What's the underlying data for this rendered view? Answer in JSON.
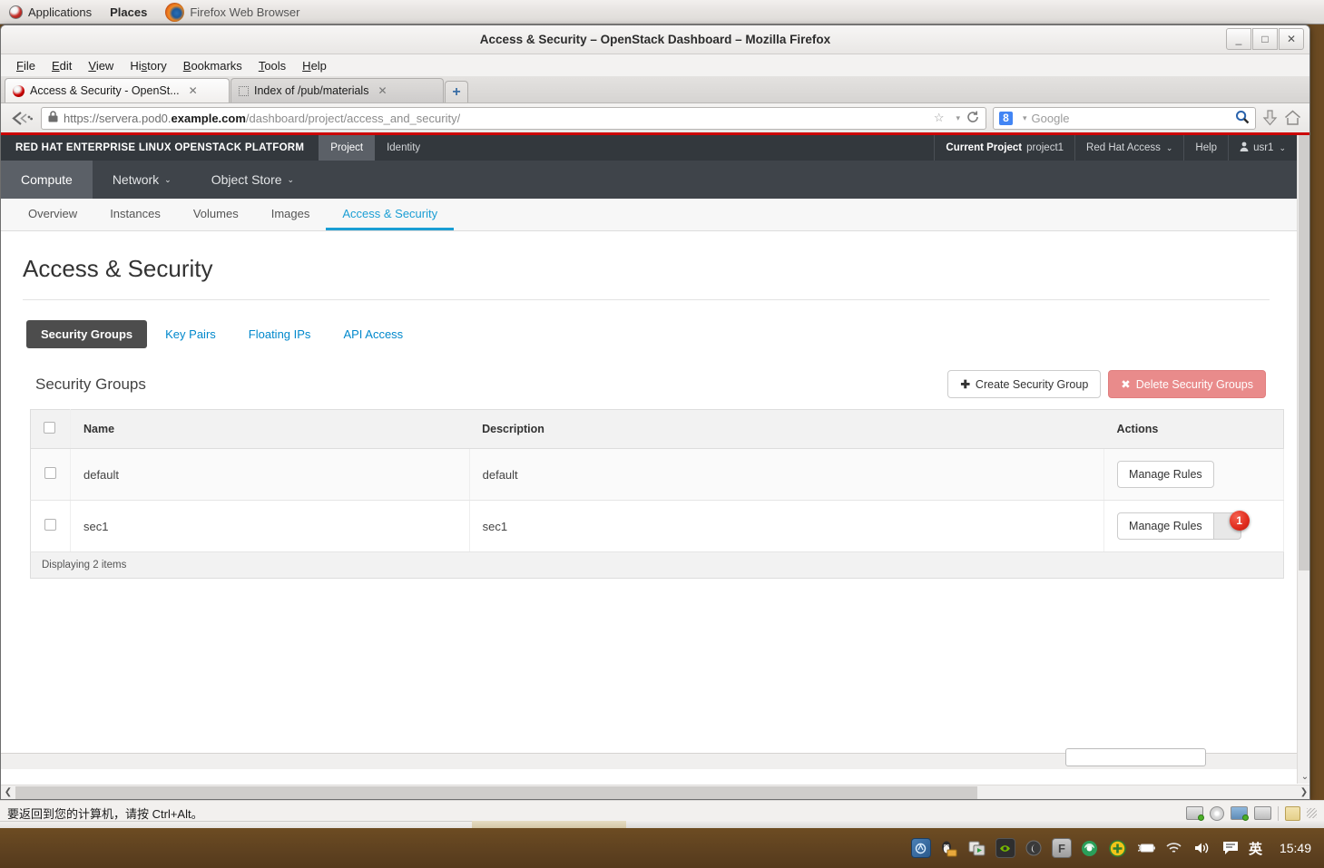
{
  "gnome_panel": {
    "applications": "Applications",
    "places": "Places",
    "window_label": "Firefox Web Browser"
  },
  "browser": {
    "window_title": "Access & Security – OpenStack Dashboard – Mozilla Firefox",
    "controls": {
      "minimize": "_",
      "maximize": "□",
      "close": "✕"
    },
    "menus": [
      "File",
      "Edit",
      "View",
      "History",
      "Bookmarks",
      "Tools",
      "Help"
    ],
    "tabs": [
      {
        "title": "Access & Security - OpenSt...",
        "close": "✕",
        "active": true
      },
      {
        "title": "Index of /pub/materials",
        "close": "✕",
        "active": false
      }
    ],
    "new_tab_label": "+",
    "url": {
      "scheme": "https://servera.pod0.",
      "domain": "example.com",
      "path": "/dashboard/project/access_and_security/"
    },
    "search": {
      "engine": "Google",
      "engine_badge": "8"
    }
  },
  "openstack": {
    "brand": "RED HAT ENTERPRISE LINUX OPENSTACK PLATFORM",
    "brand_sup": "®",
    "top_tabs": [
      {
        "label": "Project",
        "active": true
      },
      {
        "label": "Identity",
        "active": false
      }
    ],
    "top_right": {
      "current_project_label": "Current Project",
      "current_project_value": "project1",
      "red_hat_access": "Red Hat Access",
      "help": "Help",
      "user": "usr1"
    },
    "nav": [
      {
        "label": "Compute",
        "active": true,
        "caret": false
      },
      {
        "label": "Network",
        "active": false,
        "caret": true
      },
      {
        "label": "Object Store",
        "active": false,
        "caret": true
      }
    ],
    "subnav": [
      {
        "label": "Overview",
        "active": false
      },
      {
        "label": "Instances",
        "active": false
      },
      {
        "label": "Volumes",
        "active": false
      },
      {
        "label": "Images",
        "active": false
      },
      {
        "label": "Access & Security",
        "active": true
      }
    ],
    "page_title": "Access & Security",
    "pill_tabs": [
      {
        "label": "Security Groups",
        "active": true
      },
      {
        "label": "Key Pairs",
        "active": false
      },
      {
        "label": "Floating IPs",
        "active": false
      },
      {
        "label": "API Access",
        "active": false
      }
    ],
    "panel": {
      "title": "Security Groups",
      "create_button": "Create Security Group",
      "create_icon": "✚",
      "delete_button": "Delete Security Groups",
      "delete_icon": "✖"
    },
    "table": {
      "headers": [
        "Name",
        "Description",
        "Actions"
      ],
      "rows": [
        {
          "name": "default",
          "description": "default",
          "action": "Manage Rules",
          "badge": ""
        },
        {
          "name": "sec1",
          "description": "sec1",
          "action": "Manage Rules",
          "badge": "1"
        }
      ],
      "footer": "Displaying 2 items"
    },
    "accent_color": "#1a9ed4",
    "brandbar_color": "#33383d",
    "redbar_color": "#cc0000"
  },
  "vm_statusbar": {
    "message": "要返回到您的计算机，请按 Ctrl+Alt。"
  },
  "taskbar": {
    "clock": "15:49",
    "ime": "英"
  }
}
